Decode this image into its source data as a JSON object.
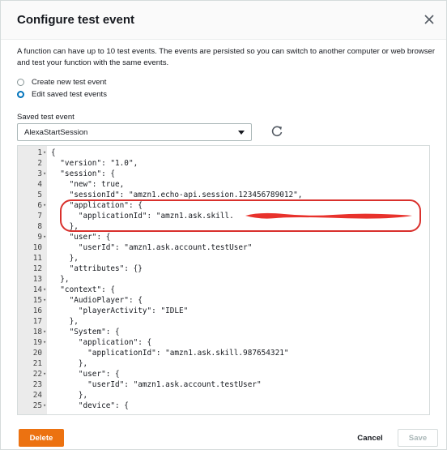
{
  "dialog": {
    "title": "Configure test event",
    "description": "A function can have up to 10 test events. The events are persisted so you can switch to another computer or web browser and test your function with the same events."
  },
  "options": {
    "create_label": "Create new test event",
    "edit_label": "Edit saved test events",
    "selected": "edit"
  },
  "saved_event": {
    "label": "Saved test event",
    "value": "AlexaStartSession"
  },
  "editor": {
    "lines": [
      {
        "n": "1",
        "fold": true,
        "text": "{"
      },
      {
        "n": "2",
        "fold": false,
        "text": "  \"version\": \"1.0\","
      },
      {
        "n": "3",
        "fold": true,
        "text": "  \"session\": {"
      },
      {
        "n": "4",
        "fold": false,
        "text": "    \"new\": true,"
      },
      {
        "n": "5",
        "fold": false,
        "text": "    \"sessionId\": \"amzn1.echo-api.session.123456789012\","
      },
      {
        "n": "6",
        "fold": true,
        "text": "    \"application\": {"
      },
      {
        "n": "7",
        "fold": false,
        "text": "      \"applicationId\": \"amzn1.ask.skill."
      },
      {
        "n": "8",
        "fold": false,
        "text": "    },"
      },
      {
        "n": "9",
        "fold": true,
        "text": "    \"user\": {"
      },
      {
        "n": "10",
        "fold": false,
        "text": "      \"userId\": \"amzn1.ask.account.testUser\""
      },
      {
        "n": "11",
        "fold": false,
        "text": "    },"
      },
      {
        "n": "12",
        "fold": false,
        "text": "    \"attributes\": {}"
      },
      {
        "n": "13",
        "fold": false,
        "text": "  },"
      },
      {
        "n": "14",
        "fold": true,
        "text": "  \"context\": {"
      },
      {
        "n": "15",
        "fold": true,
        "text": "    \"AudioPlayer\": {"
      },
      {
        "n": "16",
        "fold": false,
        "text": "      \"playerActivity\": \"IDLE\""
      },
      {
        "n": "17",
        "fold": false,
        "text": "    },"
      },
      {
        "n": "18",
        "fold": true,
        "text": "    \"System\": {"
      },
      {
        "n": "19",
        "fold": true,
        "text": "      \"application\": {"
      },
      {
        "n": "20",
        "fold": false,
        "text": "        \"applicationId\": \"amzn1.ask.skill.987654321\""
      },
      {
        "n": "21",
        "fold": false,
        "text": "      },"
      },
      {
        "n": "22",
        "fold": true,
        "text": "      \"user\": {"
      },
      {
        "n": "23",
        "fold": false,
        "text": "        \"userId\": \"amzn1.ask.account.testUser\""
      },
      {
        "n": "24",
        "fold": false,
        "text": "      },"
      },
      {
        "n": "25",
        "fold": true,
        "text": "      \"device\": {"
      }
    ]
  },
  "footer": {
    "delete_label": "Delete",
    "cancel_label": "Cancel",
    "save_label": "Save"
  },
  "colors": {
    "accent": "#0073bb",
    "delete": "#ec7211",
    "annotation": "#d9302c",
    "redaction": "#e8322c"
  },
  "icons": {
    "close": "close-icon",
    "refresh": "refresh-icon",
    "caret": "caret-down-icon"
  }
}
